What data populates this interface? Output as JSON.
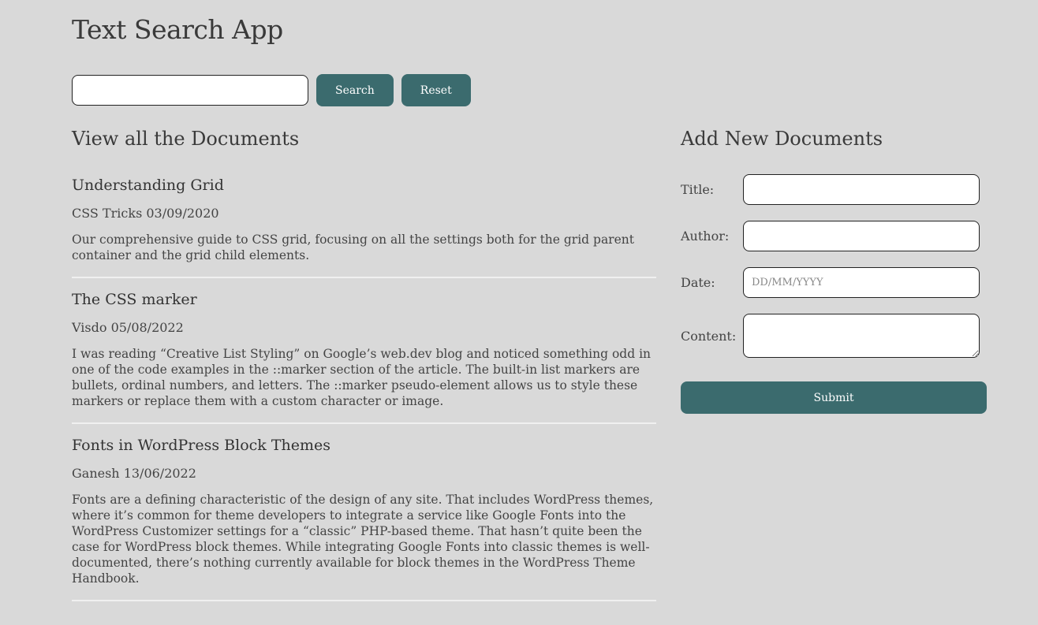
{
  "app": {
    "title": "Text Search App"
  },
  "search": {
    "value": "",
    "search_label": "Search",
    "reset_label": "Reset"
  },
  "documents": {
    "heading": "View all the Documents",
    "items": [
      {
        "title": "Understanding Grid",
        "meta": "CSS Tricks 03/09/2020",
        "content": "Our comprehensive guide to CSS grid, focusing on all the settings both for the grid parent container and the grid child elements."
      },
      {
        "title": "The CSS marker",
        "meta": "Visdo 05/08/2022",
        "content": "I was reading “Creative List Styling” on Google’s web.dev blog and noticed something odd in one of the code examples in the ::marker section of the article. The built-in list markers are bullets, ordinal numbers, and letters. The ::marker pseudo-element allows us to style these markers or replace them with a custom character or image."
      },
      {
        "title": "Fonts in WordPress Block Themes",
        "meta": "Ganesh 13/06/2022",
        "content": "Fonts are a defining characteristic of the design of any site. That includes WordPress themes, where it’s common for theme developers to integrate a service like Google Fonts into the WordPress Customizer settings for a “classic” PHP-based theme. That hasn’t quite been the case for WordPress block themes. While integrating Google Fonts into classic themes is well-documented, there’s nothing currently available for block themes in the WordPress Theme Handbook."
      }
    ]
  },
  "add_form": {
    "heading": "Add New Documents",
    "title_label": "Title:",
    "author_label": "Author:",
    "date_label": "Date:",
    "date_placeholder": "DD/MM/YYYY",
    "content_label": "Content:",
    "submit_label": "Submit"
  },
  "colors": {
    "background": "#d9d9d9",
    "accent": "#3b6b6e",
    "divider": "#f0f0f0"
  }
}
